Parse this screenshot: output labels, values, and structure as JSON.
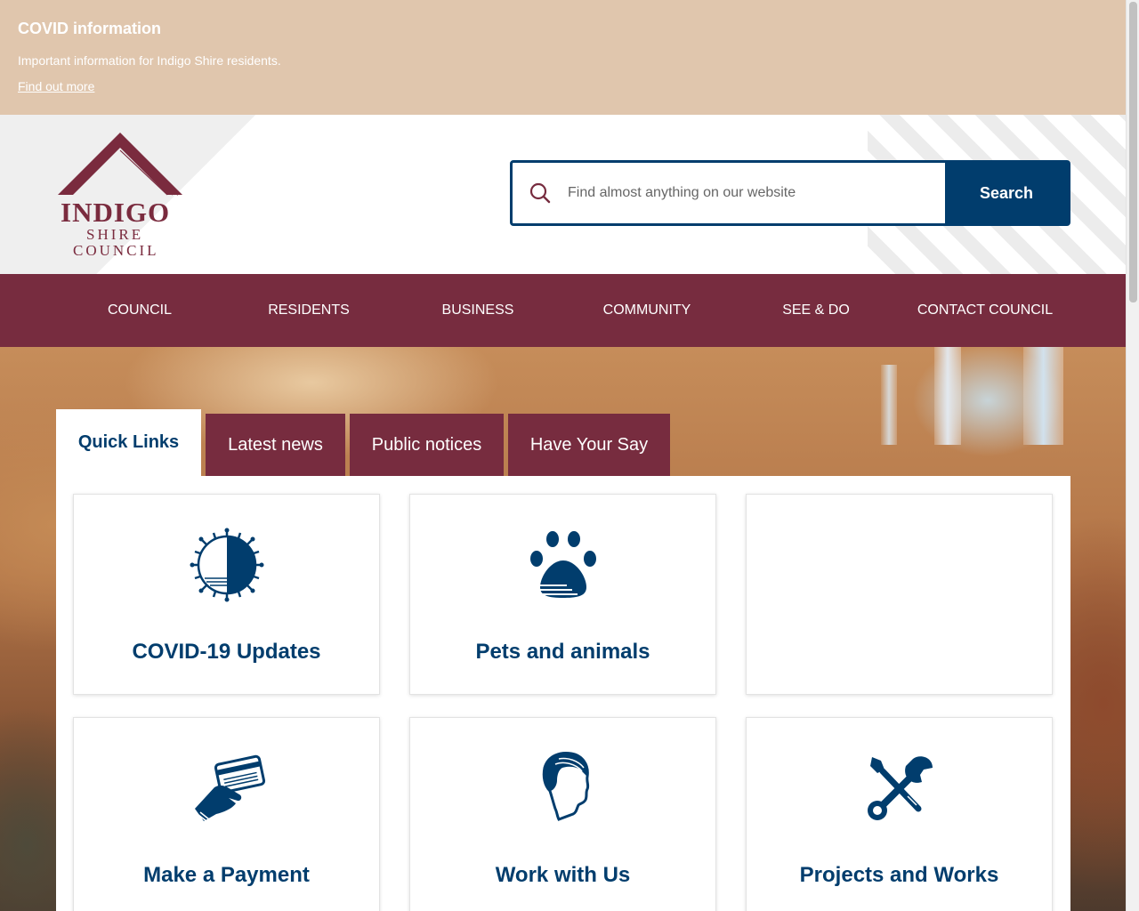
{
  "banner": {
    "title": "COVID information",
    "text": "Important information for Indigo Shire residents.",
    "link": "Find out more"
  },
  "logo": {
    "line1": "INDIGO",
    "line2": "SHIRE",
    "line3": "COUNCIL"
  },
  "search": {
    "placeholder": "Find almost anything on our website",
    "button_label": "Search"
  },
  "nav": {
    "items": [
      "COUNCIL",
      "RESIDENTS",
      "BUSINESS",
      "COMMUNITY",
      "SEE & DO",
      "CONTACT COUNCIL"
    ]
  },
  "tabs": [
    "Quick Links",
    "Latest news",
    "Public notices",
    "Have Your Say"
  ],
  "cards": [
    {
      "label": "COVID-19 Updates",
      "icon": "virus-icon"
    },
    {
      "label": "Pets and animals",
      "icon": "paw-icon"
    },
    {
      "label": "",
      "icon": ""
    },
    {
      "label": "Make a Payment",
      "icon": "card-payment-icon"
    },
    {
      "label": "Work with Us",
      "icon": "person-head-icon"
    },
    {
      "label": "Projects and Works",
      "icon": "tools-icon"
    }
  ],
  "colors": {
    "banner_bg": "#e0c6ad",
    "brand_maroon": "#772c3f",
    "brand_navy": "#013d6d"
  }
}
